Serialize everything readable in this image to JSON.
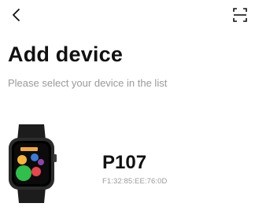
{
  "header": {
    "back_icon": "chevron-left-icon",
    "scan_icon": "scan-icon"
  },
  "main": {
    "title": "Add device",
    "subtitle": "Please select your device in the list"
  },
  "devices": [
    {
      "name": "P107",
      "mac": "F1:32:85:EE:76:0D",
      "image_icon": "smartwatch-image"
    }
  ],
  "colors": {
    "title_text": "#111111",
    "secondary_text": "#9a9a9a",
    "background": "#ffffff"
  }
}
